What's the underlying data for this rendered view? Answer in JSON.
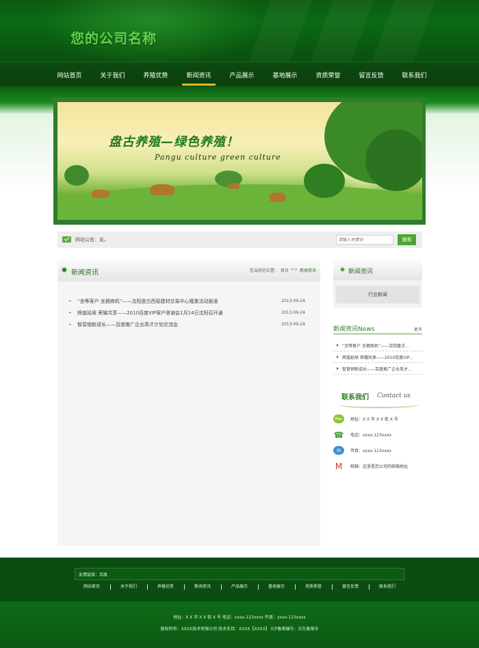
{
  "header": {
    "company_name": "您的公司名称"
  },
  "nav": {
    "items": [
      "网站首页",
      "关于我们",
      "养殖优势",
      "新闻资讯",
      "产品展示",
      "基地展示",
      "资质荣誉",
      "留言反馈",
      "联系我们"
    ],
    "active_index": 3
  },
  "banner": {
    "title": "盘古养殖—绿色养殖！",
    "subtitle": "Pangu culture green culture"
  },
  "notice": {
    "text": "网站公告：友。",
    "search_placeholder": "请输入关键词",
    "search_button": "搜索"
  },
  "main": {
    "title": "新闻资讯",
    "breadcrumb": {
      "prefix": "您当前的位置：",
      "home": "首页",
      "separator": ">>",
      "current": "新闻资讯"
    },
    "news": [
      {
        "title": "“坐等客户 坐拥商机”——沈阳盘古西窑建材交易中心隆重活动报道",
        "date": "2013-09-24"
      },
      {
        "title": "辉煌延续 荣耀共享——2010百度VIP客户答谢会1月14日沈阳召开通",
        "date": "2013-09-24"
      },
      {
        "title": "智营销新成长——百度推广企业英才计划交流会",
        "date": "2013-09-24"
      }
    ]
  },
  "sidebar": {
    "category_title": "新闻资讯",
    "category_item": "行业新闻",
    "news_title": "新闻资讯News",
    "news_more": "更多",
    "news": [
      "“坐等客户 坐拥商机”——沈阳盘古…",
      "辉煌延续 荣耀共享——2010百度VIP…",
      "智营销新成长——百度推广企业英才…"
    ],
    "contact_title": "联系我们",
    "contact_title_en": "Contact us",
    "contact": [
      {
        "icon": "address-icon",
        "text": "地址：X X 市 X X 街 X 号"
      },
      {
        "icon": "phone-icon",
        "text": "电话：xxxx-123xxxx"
      },
      {
        "icon": "fax-icon",
        "text": "传真：xxxx-123xxxx"
      },
      {
        "icon": "mail-icon",
        "text": "邮箱：这里是您公司的邮箱地址"
      }
    ],
    "contact_icon_labels": [
      "Map",
      "☎",
      "✉",
      "M"
    ]
  },
  "footer": {
    "friend_links": "友情链接：百度",
    "nav": [
      "网站首页",
      "关于我们",
      "养殖优势",
      "新闻资讯",
      "产品展示",
      "基地展示",
      "资质荣誉",
      "留言反馈",
      "联系我们"
    ],
    "address_line": "地址：X X 市 X X 街 X 号  电话：xxxx-123xxxx  传真：xxxx-123xxxx",
    "copyright_line": "版权所有：XXXX技术有限公司    技术支持：XXXX【XXXX】    ICP备案编号：正在备案中"
  },
  "colors": {
    "brand_green": "#0a4f0e",
    "accent_green": "#4ea433",
    "nav_active": "#e8b52a"
  }
}
